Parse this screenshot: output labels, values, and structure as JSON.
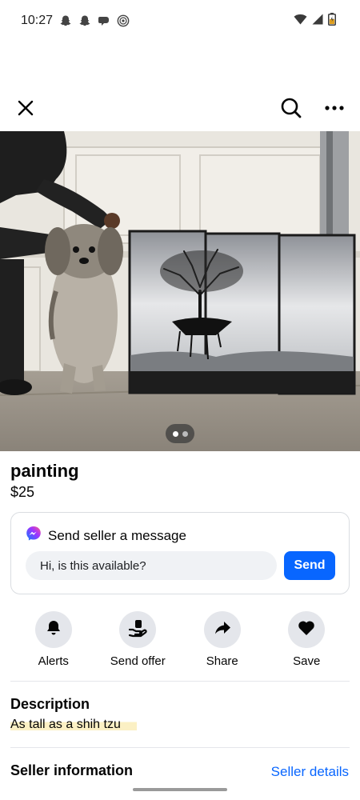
{
  "status_bar": {
    "time": "10:27",
    "notifications": [
      "snapchat-icon",
      "snapchat-icon",
      "chat-icon",
      "threads-icon"
    ],
    "right_icons": [
      "wifi-icon",
      "signal-icon",
      "battery-icon"
    ]
  },
  "top_bar": {
    "close_icon": "close-icon",
    "search_icon": "search-icon",
    "more_icon": "more-icon"
  },
  "photo": {
    "image_count": 2,
    "current_index": 1
  },
  "listing": {
    "title": "painting",
    "price": "$25"
  },
  "message_card": {
    "header": "Send seller a message",
    "input_value": "Hi, is this available?",
    "send_label": "Send"
  },
  "actions": [
    {
      "label": "Alerts",
      "icon": "bell-icon"
    },
    {
      "label": "Send offer",
      "icon": "offer-icon"
    },
    {
      "label": "Share",
      "icon": "share-icon"
    },
    {
      "label": "Save",
      "icon": "heart-icon"
    }
  ],
  "description": {
    "heading": "Description",
    "text": "As tall as a shih tzu"
  },
  "seller": {
    "heading": "Seller information",
    "details_link": "Seller details"
  },
  "colors": {
    "accent": "#0866ff",
    "chip_bg": "#e4e6eb",
    "highlight": "#fbf0c4"
  }
}
